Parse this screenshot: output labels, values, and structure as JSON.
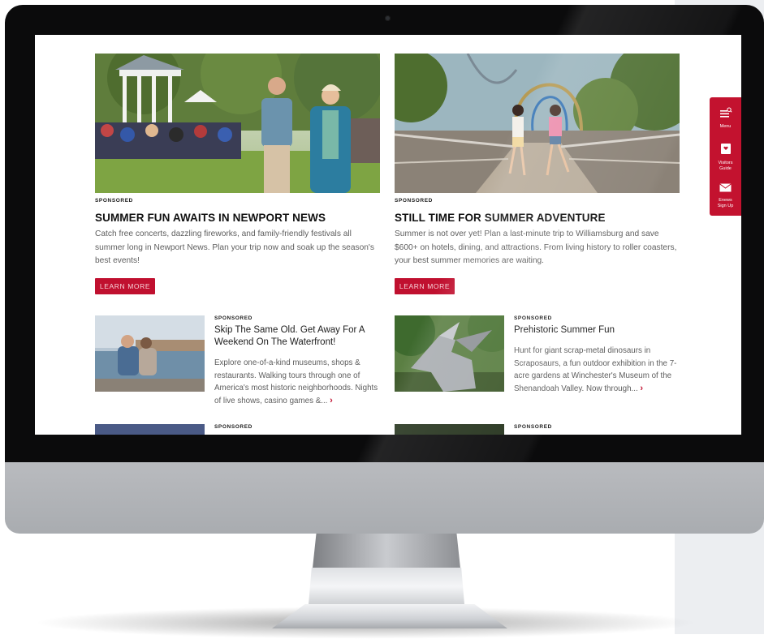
{
  "cards_top": [
    {
      "sponsored": "SPONSORED",
      "title": "SUMMER FUN AWAITS IN NEWPORT NEWS",
      "body": "Catch free concerts, dazzling fireworks, and family-friendly festivals all summer long in Newport News. Plan your trip now and soak up the season's best events!",
      "button": "LEARN MORE"
    },
    {
      "sponsored": "SPONSORED",
      "title": "STILL TIME FOR SUMMER ADVENTURE",
      "body": "Summer is not over yet! Plan a last-minute trip to Williamsburg and save $600+ on hotels, dining, and attractions. From living history to roller coasters, your best summer memories are waiting.",
      "button": "LEARN MORE"
    }
  ],
  "cards_small": [
    {
      "sponsored": "SPONSORED",
      "title": "Skip The Same Old. Get Away For A Weekend On The Waterfront!",
      "body": "Explore one-of-a-kind museums, shops & restaurants. Walking tours through one of America's most historic neighborhoods. Nights of live shows, casino games &...",
      "more": "›"
    },
    {
      "sponsored": "SPONSORED",
      "title": "Prehistoric Summer Fun",
      "body": "Hunt for giant scrap-metal dinosaurs in Scraposaurs, a fun outdoor exhibition in the 7-acre gardens at Winchester's Museum of the Shenandoah Valley. Now through...",
      "more": "›"
    }
  ],
  "cards_bottom": [
    {
      "sponsored": "SPONSORED"
    },
    {
      "sponsored": "SPONSORED"
    }
  ],
  "sidetab": {
    "menu": "Menu",
    "visitors_guide_1": "Visitors",
    "visitors_guide_2": "Guide",
    "enews_1": "Enews",
    "enews_2": "Sign Up"
  },
  "colors": {
    "accent": "#c0102f",
    "bezel": "#0b0b0c"
  },
  "icons": [
    "menu-search-icon",
    "visitors-guide-icon",
    "mail-icon",
    "chevron-right-icon",
    "camera-icon"
  ]
}
